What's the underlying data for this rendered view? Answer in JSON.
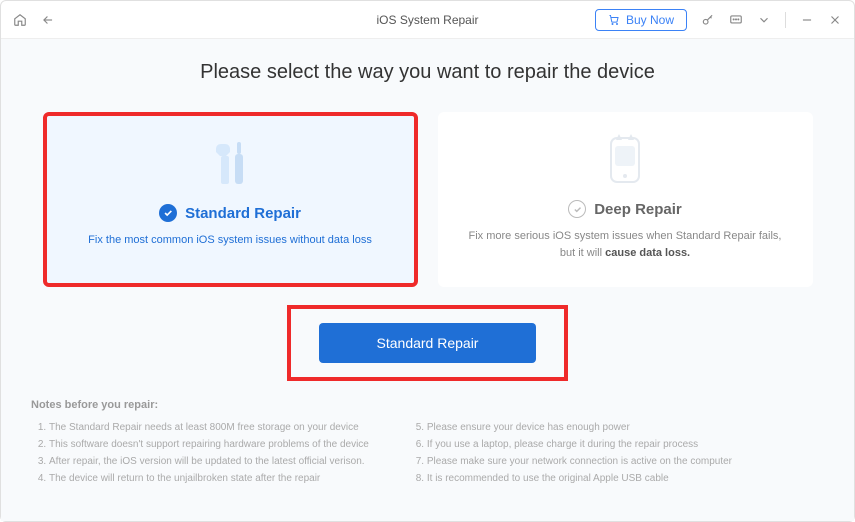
{
  "titlebar": {
    "title": "iOS System Repair",
    "buy_now": "Buy Now"
  },
  "page_title": "Please select the way you want to repair the device",
  "cards": {
    "standard": {
      "title": "Standard Repair",
      "desc": "Fix the most common iOS system issues without data loss"
    },
    "deep": {
      "title": "Deep Repair",
      "desc_prefix": "Fix more serious iOS system issues when Standard Repair fails, but it will ",
      "desc_bold": "cause data loss."
    }
  },
  "action_button": "Standard Repair",
  "notes": {
    "title": "Notes before you repair:",
    "col1": [
      "The Standard Repair needs at least 800M free storage on your device",
      "This software doesn't support repairing hardware problems of the device",
      "After repair, the iOS version will be updated to the latest official verison.",
      "The device will return to the unjailbroken state after the repair"
    ],
    "col2": [
      "Please ensure your device has enough power",
      "If you use a laptop, please charge it during the repair process",
      "Please make sure your network connection is active on the computer",
      "It is recommended to use the original Apple USB cable"
    ]
  }
}
